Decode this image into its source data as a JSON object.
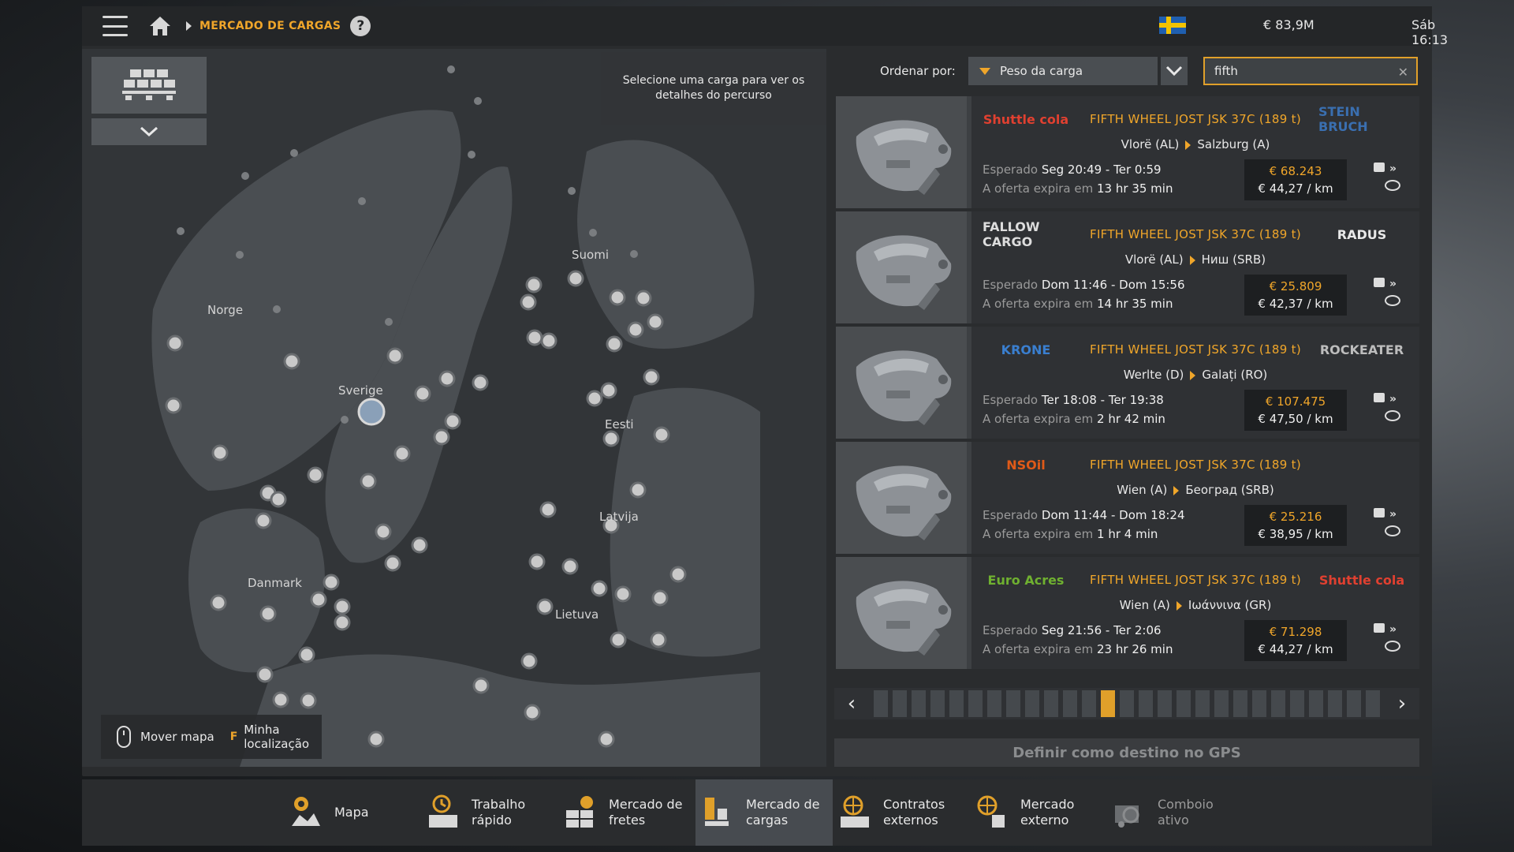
{
  "topbar": {
    "breadcrumb": "MERCADO DE CARGAS",
    "help": "?",
    "money": "€ 83,9M",
    "clock": "Sáb 16:13"
  },
  "map": {
    "hint": "Selecione uma carga para ver os detalhes do percurso",
    "labels": {
      "norge": "Norge",
      "sverige": "Sverige",
      "suomi": "Suomi",
      "eesti": "Eesti",
      "latvija": "Latvija",
      "lietuva": "Lietuva",
      "danmark": "Danmark"
    },
    "controls": {
      "move": "Mover mapa",
      "key": "F",
      "locate": "Minha localização"
    }
  },
  "sort": {
    "label": "Ordenar por:",
    "value": "Peso da carga"
  },
  "search": {
    "value": "fifth"
  },
  "offers": [
    {
      "logo_left": "Shuttle cola",
      "logo_right": "STEIN BRUCH",
      "cargo": "FIFTH WHEEL JOST JSK 37C (189 t)",
      "from": "Vlorë (AL)",
      "to": "Salzburg (A)",
      "expected_label": "Esperado",
      "expected": "Seg 20:49 - Ter 0:59",
      "expires_label": "A oferta expira em",
      "expires": "13 hr 35 min",
      "price": "€ 68.243",
      "per_km": "€ 44,27 / km"
    },
    {
      "logo_left": "FALLOW CARGO",
      "logo_right": "RADUS",
      "cargo": "FIFTH WHEEL JOST JSK 37C (189 t)",
      "from": "Vlorë (AL)",
      "to": "Ниш (SRB)",
      "expected_label": "Esperado",
      "expected": "Dom 11:46 - Dom 15:56",
      "expires_label": "A oferta expira em",
      "expires": "14 hr 35 min",
      "price": "€ 25.809",
      "per_km": "€ 42,37 / km"
    },
    {
      "logo_left": "KRONE",
      "logo_right": "ROCKEATER",
      "cargo": "FIFTH WHEEL JOST JSK 37C (189 t)",
      "from": "Werlte (D)",
      "to": "Galați (RO)",
      "expected_label": "Esperado",
      "expected": "Ter 18:08 - Ter 19:38",
      "expires_label": "A oferta expira em",
      "expires": "2 hr 42 min",
      "price": "€ 107.475",
      "per_km": "€ 47,50 / km"
    },
    {
      "logo_left": "NSOil",
      "logo_right": "",
      "cargo": "FIFTH WHEEL JOST JSK 37C (189 t)",
      "from": "Wien (A)",
      "to": "Београд (SRB)",
      "expected_label": "Esperado",
      "expected": "Dom 11:44 - Dom 18:24",
      "expires_label": "A oferta expira em",
      "expires": "1 hr 4 min",
      "price": "€ 25.216",
      "per_km": "€ 38,95 / km"
    },
    {
      "logo_left": "Euro Acres",
      "logo_right": "Shuttle cola",
      "cargo": "FIFTH WHEEL JOST JSK 37C (189 t)",
      "from": "Wien (A)",
      "to": "Ιωάννινα (GR)",
      "expected_label": "Esperado",
      "expected": "Seg 21:56 - Ter 2:06",
      "expires_label": "A oferta expira em",
      "expires": "23 hr 26 min",
      "price": "€ 71.298",
      "per_km": "€ 44,27 / km"
    }
  ],
  "pager": {
    "total_pages": 27,
    "current_page": 13
  },
  "gps_button": "Definir como destino no GPS",
  "bottom_tabs": [
    {
      "label": "Mapa",
      "icon": "map-icon"
    },
    {
      "label": "Trabalho\nrápido",
      "icon": "quick-job-icon"
    },
    {
      "label": "Mercado de\nfretes",
      "icon": "freight-market-icon"
    },
    {
      "label": "Mercado de\ncargas",
      "icon": "cargo-market-icon"
    },
    {
      "label": "Contratos\nexternos",
      "icon": "external-contracts-icon"
    },
    {
      "label": "Mercado\nexterno",
      "icon": "external-market-icon"
    },
    {
      "label": "Comboio\nativo",
      "icon": "active-convoy-icon"
    }
  ],
  "colors": {
    "accent": "#f0a62a",
    "panel": "#2a2c2e"
  }
}
